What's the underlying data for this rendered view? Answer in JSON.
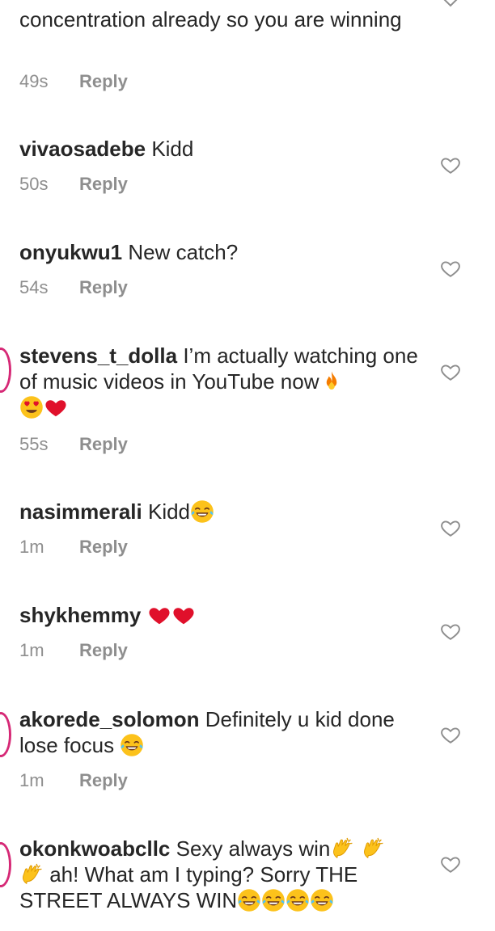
{
  "comments": [
    {
      "user": "",
      "text": "concentration already so you are winning",
      "time": "49s",
      "reply": "Reply"
    },
    {
      "user": "vivaosadebe",
      "text": " Kidd",
      "time": "50s",
      "reply": "Reply"
    },
    {
      "user": "onyukwu1",
      "text": " New catch?",
      "time": "54s",
      "reply": "Reply"
    },
    {
      "user": "stevens_t_dolla",
      "text": " I’m actually watching one of music videos in YouTube now",
      "time": "55s",
      "reply": "Reply"
    },
    {
      "user": "nasimmerali",
      "text": " Kidd",
      "time": "1m",
      "reply": "Reply"
    },
    {
      "user": "shykhemmy",
      "text": " ",
      "time": "1m",
      "reply": "Reply"
    },
    {
      "user": "akorede_solomon",
      "text": " Definitely u kid done lose focus ",
      "time": "1m",
      "reply": "Reply"
    },
    {
      "user": "okonkwoabcllc",
      "text": " Sexy always win",
      "text2": " ah! What am I typing? Sorry THE STREET ALWAYS WIN",
      "time": "",
      "reply": ""
    }
  ],
  "emojis": {
    "c3": [
      "fire",
      "heart-eyes",
      "red-heart"
    ],
    "c4": [
      "joy"
    ],
    "c5": [
      "red-heart",
      "red-heart"
    ],
    "c6": [
      "joy"
    ],
    "c7": [
      "clapping-hands",
      "clapping-hands",
      "clapping-hands",
      "joy",
      "joy",
      "joy",
      "joy"
    ]
  },
  "colors": {
    "text": "#262626",
    "meta": "#8e8e8e",
    "heart_outline": "#8e8e8e",
    "emoji_red": "#e0102b",
    "emoji_yellow": "#fcc21b",
    "story_ring": "#d62976"
  }
}
